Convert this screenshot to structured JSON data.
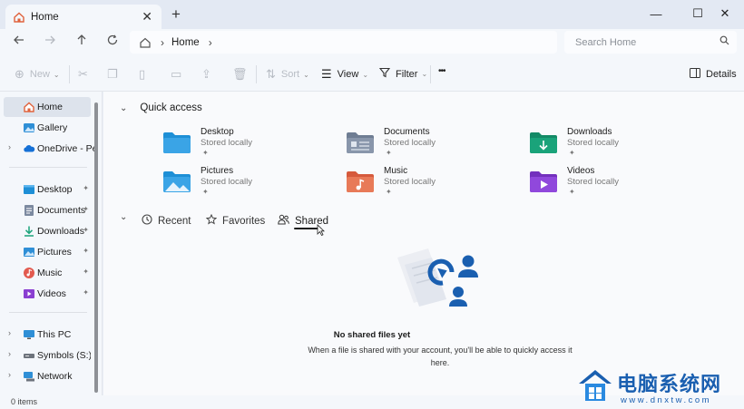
{
  "window": {
    "tab_title": "Home",
    "tab_close": "✕",
    "new_tab": "+",
    "minimize": "—",
    "maximize": "☐",
    "close": "✕"
  },
  "address": {
    "crumb": "Home",
    "search_placeholder": "Search Home"
  },
  "commands": {
    "new": "New",
    "sort": "Sort",
    "view": "View",
    "filter": "Filter",
    "more": "•••",
    "details": "Details"
  },
  "sidebar": {
    "items": [
      {
        "label": "Home",
        "selected": true
      },
      {
        "label": "Gallery"
      },
      {
        "label": "OneDrive - Perso"
      },
      {
        "label": "Desktop"
      },
      {
        "label": "Documents"
      },
      {
        "label": "Downloads"
      },
      {
        "label": "Pictures"
      },
      {
        "label": "Music"
      },
      {
        "label": "Videos"
      },
      {
        "label": "This PC"
      },
      {
        "label": "Symbols (S:)"
      },
      {
        "label": "Network"
      }
    ]
  },
  "quick_access": {
    "title": "Quick access",
    "items": [
      {
        "name": "Desktop",
        "sub": "Stored locally",
        "color": "#1e8fd6"
      },
      {
        "name": "Documents",
        "sub": "Stored locally",
        "color": "#7c8aa0"
      },
      {
        "name": "Downloads",
        "sub": "Stored locally",
        "color": "#1aa37a"
      },
      {
        "name": "Pictures",
        "sub": "Stored locally",
        "color": "#1e8fd6"
      },
      {
        "name": "Music",
        "sub": "Stored locally",
        "color": "#e26a4f"
      },
      {
        "name": "Videos",
        "sub": "Stored locally",
        "color": "#8a3fd1"
      }
    ]
  },
  "tabs_row": {
    "recent": "Recent",
    "favorites": "Favorites",
    "shared": "Shared"
  },
  "empty_state": {
    "title": "No shared files yet",
    "description": "When a file is shared with your account, you'll be able to quickly access it here."
  },
  "status": {
    "items_count": "0 items"
  },
  "watermark": {
    "text": "电脑系统网",
    "url": "www.dnxtw.com"
  },
  "colors": {
    "accent": "#1a5fb0",
    "selected_bg": "#dde3ec"
  }
}
